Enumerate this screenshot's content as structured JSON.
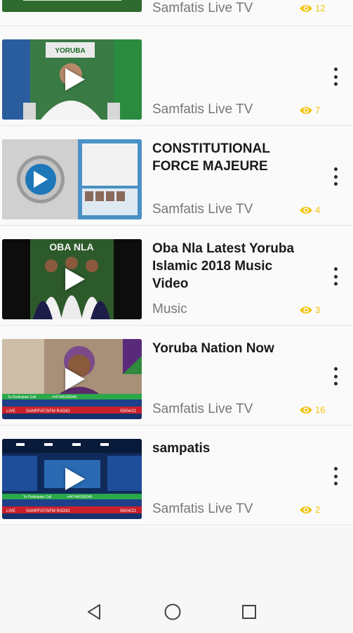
{
  "videos": [
    {
      "title": "",
      "channel": "Samfatis Live TV",
      "views": "12"
    },
    {
      "title": "",
      "channel": "Samfatis Live TV",
      "views": "7"
    },
    {
      "title": "CONSTITUTIONAL FORCE MAJEURE",
      "channel": "Samfatis Live TV",
      "views": "4"
    },
    {
      "title": "Oba Nla Latest Yoruba Islamic 2018 Music Video",
      "channel": "Music",
      "views": "3"
    },
    {
      "title": "Yoruba Nation Now",
      "channel": "Samfatis Live TV",
      "views": "16"
    },
    {
      "title": "sampatis",
      "channel": "Samfatis Live TV",
      "views": "2"
    }
  ],
  "thumb_text": {
    "yoruba_banner": "YORUBA",
    "oba_nla": "OBA NLA",
    "participate": "To Participate Call",
    "phone1": "+447446183046",
    "phone2": "+447446183046",
    "live": "LIVE",
    "radio": "SAMPFATISFM RADIO",
    "date1": "05/04/21",
    "date2": "06/04/21"
  },
  "colors": {
    "accent_views": "#f2c40a",
    "channel_text": "#777777",
    "title_text": "#1a1a1a",
    "icon_dark": "#2a2a2a"
  },
  "icons": {
    "views": "eye-icon",
    "more": "more-vert-icon",
    "play": "play-icon",
    "nav_back": "triangle-back-icon",
    "nav_home": "circle-home-icon",
    "nav_recent": "square-recent-icon"
  }
}
